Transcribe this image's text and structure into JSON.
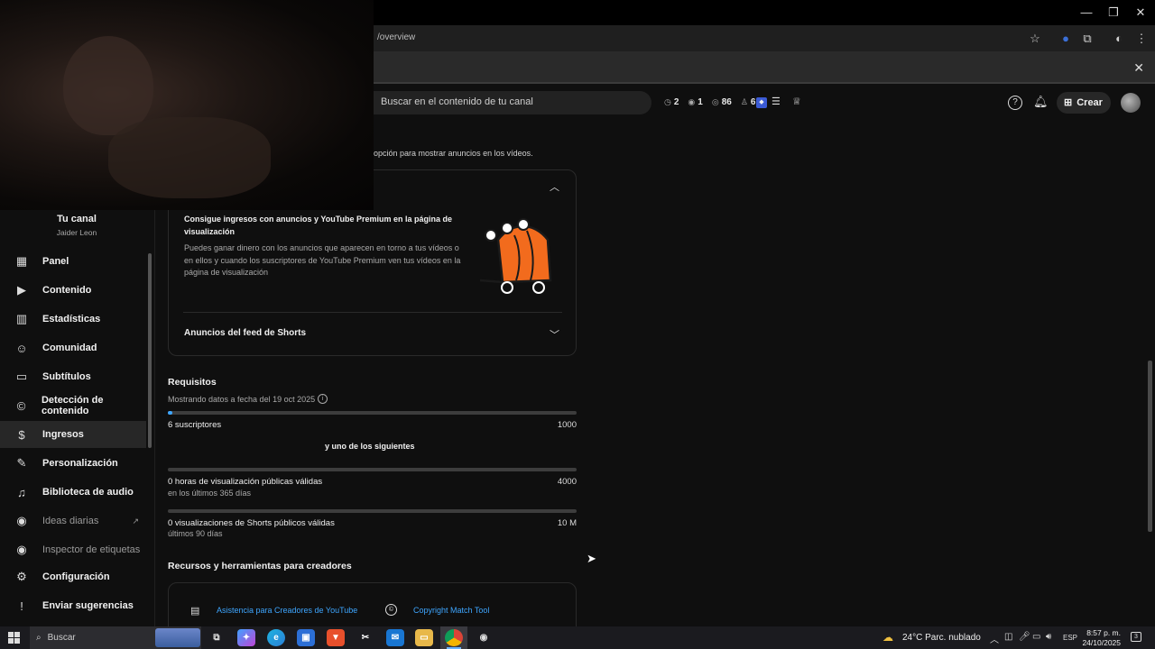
{
  "browser": {
    "url": "/overview",
    "window_controls": {
      "minimize": "—",
      "restore": "❐",
      "close": "✕"
    }
  },
  "header": {
    "search_placeholder": "Buscar en el contenido de tu canal",
    "stats": [
      {
        "icon": "clock-icon",
        "value": "2"
      },
      {
        "icon": "eye-icon",
        "value": "1"
      },
      {
        "icon": "view-icon",
        "value": "86"
      },
      {
        "icon": "person-icon",
        "value": "6"
      }
    ],
    "create_label": "Crear"
  },
  "sidebar": {
    "channel_title": "Tu canal",
    "channel_name": "Jaider Leon",
    "items": [
      {
        "label": "Panel",
        "icon": "dashboard-icon",
        "glyph": "▦"
      },
      {
        "label": "Contenido",
        "icon": "content-icon",
        "glyph": "▶"
      },
      {
        "label": "Estadísticas",
        "icon": "analytics-icon",
        "glyph": "▥"
      },
      {
        "label": "Comunidad",
        "icon": "community-icon",
        "glyph": "☺"
      },
      {
        "label": "Subtítulos",
        "icon": "subtitles-icon",
        "glyph": "▭"
      },
      {
        "label": "Detección de contenido",
        "icon": "copyright-icon",
        "glyph": "©"
      },
      {
        "label": "Ingresos",
        "icon": "dollar-icon",
        "glyph": "$"
      },
      {
        "label": "Personalización",
        "icon": "magic-wand-icon",
        "glyph": "✎"
      },
      {
        "label": "Biblioteca de audio",
        "icon": "audio-library-icon",
        "glyph": "♫"
      },
      {
        "label": "Ideas diarias",
        "icon": "ideas-icon",
        "glyph": "◉"
      },
      {
        "label": "Inspector de etiquetas",
        "icon": "tag-inspector-icon",
        "glyph": "◉"
      },
      {
        "label": "Configuración",
        "icon": "gear-icon",
        "glyph": "⚙"
      },
      {
        "label": "Enviar sugerencias",
        "icon": "feedback-icon",
        "glyph": "!"
      }
    ]
  },
  "main": {
    "top_note": "opción para mostrar anuncios en los vídeos.",
    "card": {
      "title": "Consigue ingresos con anuncios y YouTube Premium en la página de visualización",
      "body": "Puedes ganar dinero con los anuncios que aparecen en torno a tus vídeos o en ellos y cuando los suscriptores de YouTube Premium ven tus vídeos en la página de visualización",
      "shorts_label": "Anuncios del feed de Shorts"
    },
    "requirements": {
      "title": "Requisitos",
      "date_note": "Mostrando datos a fecha del 19 oct 2025",
      "subscribers": {
        "label": "6 suscriptores",
        "target": "1000",
        "progress": 0.006
      },
      "or_label": "y uno de los siguientes",
      "watch_hours": {
        "label": "0 horas de visualización públicas válidas",
        "sub": "en los últimos 365 días",
        "target": "4000",
        "progress": 0
      },
      "shorts_views": {
        "label": "0 visualizaciones de Shorts públicos válidas",
        "sub": "últimos 90 días",
        "target": "10 M",
        "progress": 0
      }
    },
    "resources": {
      "title": "Recursos y herramientas para creadores",
      "link1": "Asistencia para Creadores de YouTube",
      "link2": "Copyright Match Tool"
    }
  },
  "taskbar": {
    "search_label": "Buscar",
    "weather": "24°C  Parc. nublado",
    "lang": "ESP",
    "time": "8:57 p. m.",
    "date": "24/10/2025",
    "notification_count": "3"
  },
  "colors": {
    "accent": "#3ea6ff",
    "progress_track": "#3d3d3d",
    "illustration": "#f26b1d"
  }
}
